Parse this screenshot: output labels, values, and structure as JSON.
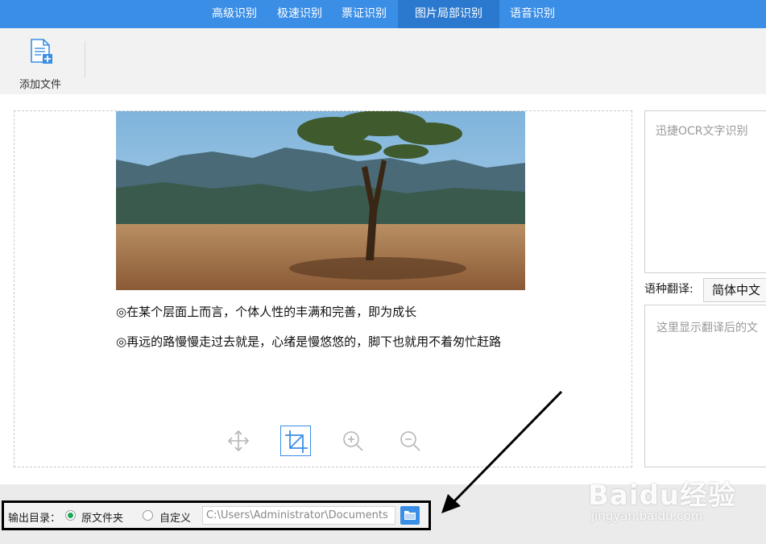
{
  "nav": {
    "tabs": [
      {
        "label": "高级识别"
      },
      {
        "label": "极速识别"
      },
      {
        "label": "票证识别"
      },
      {
        "label": "图片局部识别",
        "active": true
      },
      {
        "label": "语音识别"
      }
    ]
  },
  "toolbar": {
    "add_file_label": "添加文件",
    "add_file_icon": "add-file-icon"
  },
  "preview": {
    "captions": [
      "◎在某个层面上而言，个体人性的丰满和完善，即为成长",
      "◎再远的路慢慢走过去就是，心绪是慢悠悠的，脚下也就用不着匆忙赶路"
    ],
    "controls": [
      {
        "name": "move-icon",
        "active": false
      },
      {
        "name": "crop-icon",
        "active": true
      },
      {
        "name": "zoom-in-icon",
        "active": false
      },
      {
        "name": "zoom-out-icon",
        "active": false
      }
    ]
  },
  "ocr": {
    "placeholder": "迅捷OCR文字识别"
  },
  "translate": {
    "label": "语种翻译:",
    "selected": "简体中文",
    "placeholder": "这里显示翻译后的文"
  },
  "output": {
    "label": "输出目录：",
    "options": [
      {
        "label": "原文件夹",
        "checked": true
      },
      {
        "label": "自定义",
        "checked": false
      }
    ],
    "path": "C:\\Users\\Administrator\\Documents",
    "browse_icon": "folder-icon"
  },
  "watermark": {
    "text": "Baidu经验",
    "url": "jingyan.baidu.com"
  },
  "colors": {
    "nav_bg": "#3a8ee6",
    "nav_active": "#2b79cf",
    "radio_checked": "#21a55a",
    "highlight_border": "#000000"
  }
}
